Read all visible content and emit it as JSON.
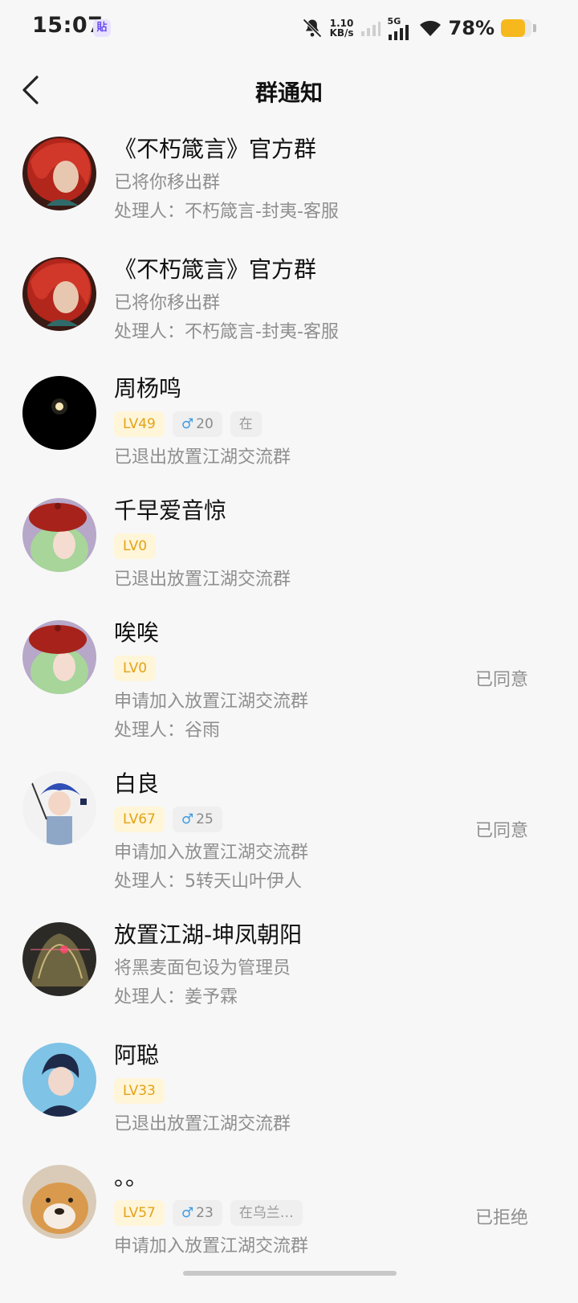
{
  "status_bar": {
    "time": "15:07",
    "app_badge": "貼",
    "net_speed_value": "1.10",
    "net_speed_unit": "KB/s",
    "network_type": "5G",
    "battery_percent": "78%",
    "battery_level": 0.78,
    "icons": [
      "mute-bell-icon",
      "signal-icon",
      "wifi-icon",
      "battery-icon"
    ]
  },
  "header": {
    "title": "群通知",
    "back_icon": "chevron-left-icon"
  },
  "notifications": [
    {
      "name": "《不朽箴言》官方群",
      "line1": "已将你移出群",
      "line2": "处理人：不朽箴言-封夷-客服"
    },
    {
      "name": "《不朽箴言》官方群",
      "line1": "已将你移出群",
      "line2": "处理人：不朽箴言-封夷-客服"
    },
    {
      "name": "周杨鸣",
      "level": "LV49",
      "gender": "♂",
      "age": "20",
      "location": "在",
      "line1": "已退出放置江湖交流群"
    },
    {
      "name": "千早爱音惊",
      "level": "LV0",
      "line1": "已退出放置江湖交流群"
    },
    {
      "name": "唉唉",
      "level": "LV0",
      "line1": "申请加入放置江湖交流群",
      "line2": "处理人：谷雨",
      "status": "已同意"
    },
    {
      "name": "白良",
      "level": "LV67",
      "gender": "♂",
      "age": "25",
      "line1": "申请加入放置江湖交流群",
      "line2": "处理人：5转天山叶伊人",
      "status": "已同意"
    },
    {
      "name": "放置江湖-坤凤朝阳",
      "line1": "将黑麦面包设为管理员",
      "line2": "处理人：姜予霖"
    },
    {
      "name": "阿聪",
      "level": "LV33",
      "line1": "已退出放置江湖交流群"
    },
    {
      "name": "。。",
      "level": "LV57",
      "gender": "♂",
      "age": "23",
      "location": "在乌兰…",
      "line1": "申请加入放置江湖交流群",
      "status": "已拒绝"
    }
  ]
}
